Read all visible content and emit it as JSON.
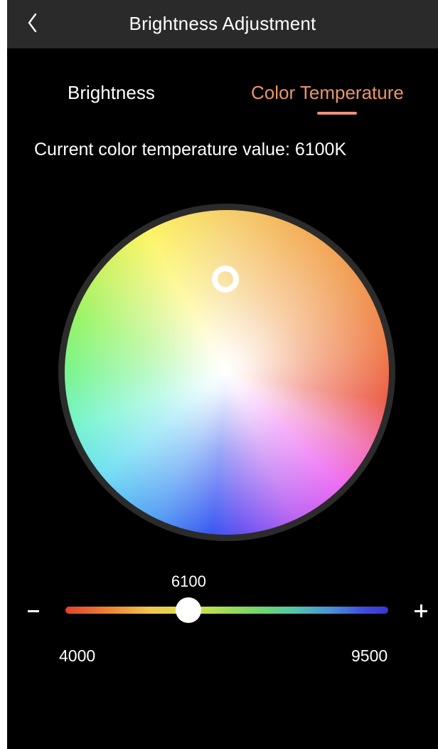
{
  "header": {
    "title": "Brightness Adjustment",
    "back_icon": "chevron-left-icon"
  },
  "tabs": [
    {
      "label": "Brightness",
      "active": false
    },
    {
      "label": "Color Temperature",
      "active": true
    }
  ],
  "colors": {
    "accent": "#e8956a",
    "tab_underline": "#f0907e",
    "background": "#000000",
    "navbar": "#2a2a2a"
  },
  "readout": {
    "text": "Current color temperature value: 6100K"
  },
  "color_wheel": {
    "handle_icon": "ring-handle-icon"
  },
  "slider": {
    "value_label": "6100",
    "value": 6100,
    "min": 4000,
    "max": 9500,
    "min_label": "4000",
    "max_label": "9500",
    "minus_label": "−",
    "plus_label": "+",
    "minus_icon": "minus-icon",
    "plus_icon": "plus-icon"
  }
}
